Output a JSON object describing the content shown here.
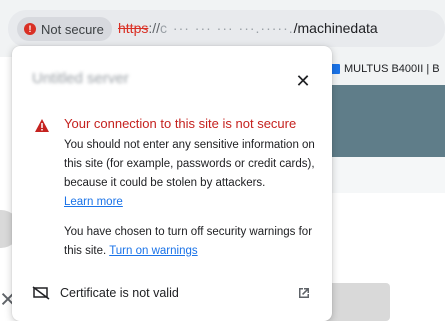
{
  "browser": {
    "security_chip": {
      "label": "Not secure",
      "icon": "warning-circle-icon",
      "color": "#d93025"
    },
    "url": {
      "scheme": "https",
      "separator": "://",
      "host_masked": "c ··· ··· ··· ···.·····.",
      "path": "/machinedata"
    },
    "bookmark": {
      "label": "MULTUS B400II | B"
    }
  },
  "popup": {
    "title_blurred": "Untitled server",
    "close_icon": "close-icon",
    "warning": {
      "icon": "warning-triangle-icon",
      "title": "Your connection to this site is not secure",
      "body": "You should not enter any sensitive information on this site (for example, passwords or credit cards), because it could be stolen by attackers.",
      "learn_more": "Learn more",
      "security_note": "You have chosen to turn off security warnings for this site.",
      "turn_on_warnings": "Turn on warnings"
    },
    "certificate": {
      "icon": "certificate-invalid-icon",
      "label": "Certificate is not valid",
      "external_icon": "open-external-icon"
    }
  },
  "colors": {
    "warning_red": "#c5221f",
    "link_blue": "#1a73e8"
  }
}
